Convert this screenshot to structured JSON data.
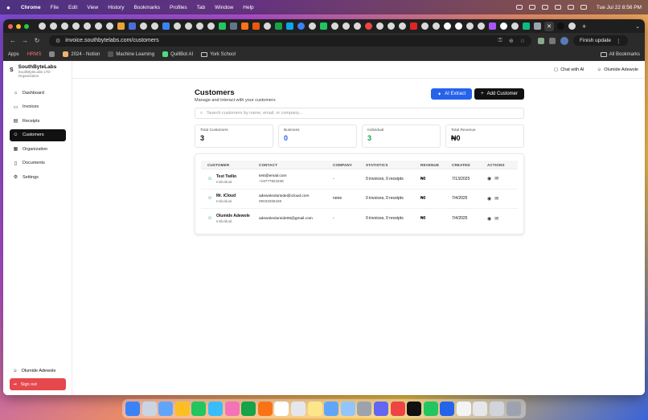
{
  "menubar": {
    "app": "Chrome",
    "items": [
      "File",
      "Edit",
      "View",
      "History",
      "Bookmarks",
      "Profiles",
      "Tab",
      "Window",
      "Help"
    ],
    "clock": "Tue Jul 22  8:56 PM"
  },
  "browser": {
    "url": "invoice.southbytelabs.com/customers",
    "update_label": "Finish update",
    "bookmarks": [
      "Apps",
      "HRMS",
      "2024 - Notion",
      "Machine Learning",
      "QuillBot AI",
      "York School"
    ],
    "all_bookmarks": "All Bookmarks"
  },
  "sidebar": {
    "brand_logo": "S",
    "brand_name": "SouthByteLabs",
    "brand_sub": "SouthByteLabs LTD",
    "brand_sub2": "Organization",
    "items": [
      {
        "label": "Dashboard",
        "icon": "home-icon"
      },
      {
        "label": "Invoices",
        "icon": "file-icon"
      },
      {
        "label": "Receipts",
        "icon": "receipt-icon"
      },
      {
        "label": "Customers",
        "icon": "users-icon"
      },
      {
        "label": "Organization",
        "icon": "building-icon"
      },
      {
        "label": "Documents",
        "icon": "document-icon"
      },
      {
        "label": "Settings",
        "icon": "gear-icon"
      }
    ],
    "user": "Olumide Adewole",
    "signout": "Sign out"
  },
  "topbar": {
    "chat": "Chat with AI",
    "user": "Olumide Adewole"
  },
  "page": {
    "title": "Customers",
    "subtitle": "Manage and interact with your customers",
    "ai_extract": "AI Extract",
    "add_customer": "Add Customer",
    "search_placeholder": "Search customers by name, email, or company..."
  },
  "stats": [
    {
      "label": "Total Customers",
      "value": "3",
      "color": "#111111"
    },
    {
      "label": "Business",
      "value": "0",
      "color": "#2563eb"
    },
    {
      "label": "Individual",
      "value": "3",
      "color": "#16a34a"
    },
    {
      "label": "Total Revenue",
      "value": "₦0",
      "color": "#111111"
    }
  ],
  "table": {
    "headers": [
      "CUSTOMER",
      "CONTACT",
      "COMPANY",
      "STATISTICS",
      "REVENUE",
      "CREATED",
      "ACTIONS"
    ],
    "rows": [
      {
        "name": "Test Twilio",
        "type": "Individual",
        "email": "test@email.com",
        "phone": "+19777824236",
        "company": "-",
        "stats": "0 invoices, 0 receipts",
        "revenue": "₦0",
        "created": "7/13/2025"
      },
      {
        "name": "Mr. iCloud",
        "type": "Individual",
        "email": "adewoleolumide@icloud.com",
        "phone": "09033268428",
        "company": "none",
        "stats": "0 invoices, 0 receipts",
        "revenue": "₦0",
        "created": "7/4/2025"
      },
      {
        "name": "Olumide Adewole",
        "type": "Individual",
        "email": "adewoleolumide05@gmail.com",
        "phone": "",
        "company": "-",
        "stats": "0 invoices, 0 receipts",
        "revenue": "₦0",
        "created": "7/4/2025"
      }
    ]
  }
}
